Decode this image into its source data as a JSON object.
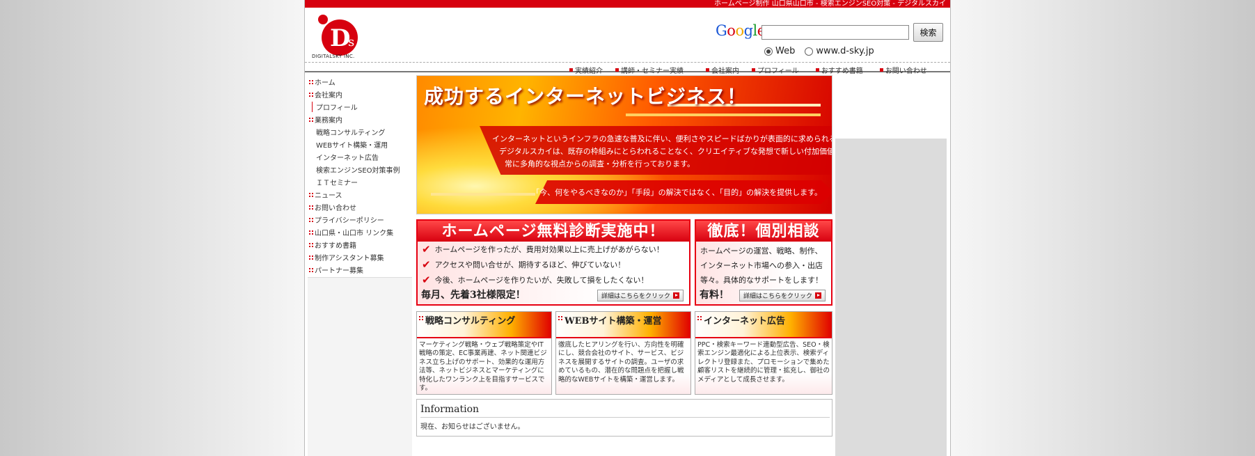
{
  "site": {
    "topbar_text": "ホームページ制作 山口県山口市 - 検索エンジンSEO対策 - デジタルスカイ",
    "logo_text": "DIGITALSKY INC.",
    "logo_mark": "Ds"
  },
  "search": {
    "google_logo": "Google",
    "input_value": "",
    "button_label": "検索",
    "radio_web": "Web",
    "radio_site": "www.d-sky.jp"
  },
  "top_nav": [
    {
      "label": "実績紹介"
    },
    {
      "label": "講師・セミナー実績"
    },
    {
      "label": "会社案内"
    },
    {
      "label": "プロフィール"
    },
    {
      "label": "おすすめ書籍"
    },
    {
      "label": "お問い合わせ"
    }
  ],
  "sidebar": {
    "items": [
      {
        "label": "ホーム"
      },
      {
        "label": "会社案内"
      },
      {
        "label": "プロフィール"
      },
      {
        "label": "業務案内"
      },
      {
        "label": "戦略コンサルティング"
      },
      {
        "label": "WEBサイト構築・運用"
      },
      {
        "label": "インターネット広告"
      },
      {
        "label": "検索エンジンSEO対策事例"
      },
      {
        "label": "ＩＴセミナー"
      },
      {
        "label": "ニュース"
      },
      {
        "label": "お問い合わせ"
      },
      {
        "label": "プライバシーポリシー"
      },
      {
        "label": "山口県・山口市 リンク集"
      },
      {
        "label": "おすすめ書籍"
      },
      {
        "label": "制作アシスタント募集"
      },
      {
        "label": "パートナー募集"
      }
    ]
  },
  "hero": {
    "title": "成功するインターネットビジネス！",
    "line1": "インターネットというインフラの急速な普及に伴い、便利さやスピードばかりが表面的に求められる時代。",
    "line2": "デジタルスカイは、既存の枠組みにとらわれることなく、クリエイティブな発想で新しい付加価値を創造し、",
    "line3": "常に多角的な視点からの調査・分析を行っております。",
    "cta": "「今、何をやるべきなのか」「手段」の解決ではなく、「目的」の解決を提供します。"
  },
  "promo_free": {
    "title": "ホームページ無料診断実施中！",
    "checks": [
      "ホームページを作ったが、費用対効果以上に売上げがあがらない！",
      "アクセスや問い合せが、期待するほど、伸びていない！",
      "今後、ホームページを作りたいが、失敗して損をしたくない！"
    ],
    "footer": "毎月、先着3社様限定！",
    "button": "詳細はこちらをクリック"
  },
  "promo_consult": {
    "title": "徹底！個別相談",
    "lines": [
      "ホームページの運営、戦略、制作、",
      "インターネット市場への参入・出店",
      "等々。具体的なサポートをします！"
    ],
    "footer": "有料！",
    "button": "詳細はこちらをクリック"
  },
  "services": [
    {
      "title": "戦略コンサルティング",
      "body": "マーケティング戦略・ウェブ戦略策定やIT戦略の策定、EC事業再建、ネット関連ビジネス立ち上げのサポート、効果的な運用方法等、ネットビジネスとマーケティングに特化したワンランク上を目指すサービスです。"
    },
    {
      "title": "WEBサイト構築・運営",
      "body": "徹底したヒアリングを行い、方向性を明確にし、競合会社のサイト、サービス、ビジネスを展開するサイトの調査。ユーザの求めているもの、潜在的な問題点を把握し戦略的なWEBサイトを構築・運営します。"
    },
    {
      "title": "インターネット広告",
      "body": "PPC・検索キーワード連動型広告、SEO・検索エンジン最適化による上位表示、検索ディレクトリ登録また、プロモーションで集めた顧客リストを継続的に管理・拡充し、御社のメディアとして成長させます。"
    }
  ],
  "info": {
    "title": "Information",
    "text": "現在、お知らせはございません。"
  },
  "colors": {
    "brand_red": "#d7000f",
    "accent_orange": "#ffb400"
  }
}
